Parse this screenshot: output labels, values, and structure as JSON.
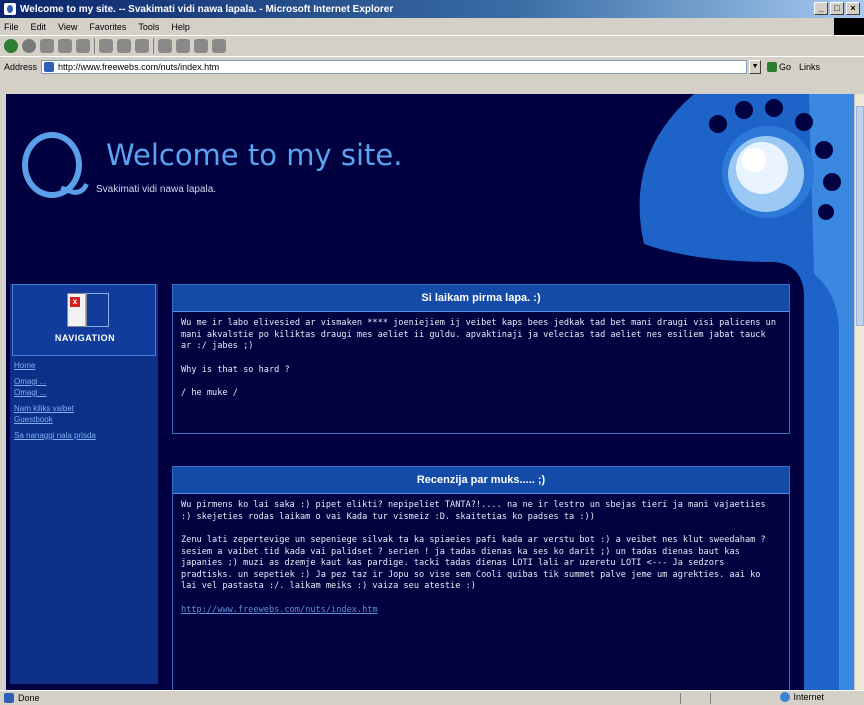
{
  "window": {
    "title": "Welcome to my site. -- Svakimati vidi nawa lapala. - Microsoft Internet Explorer",
    "buttons": [
      "_",
      "□",
      "×"
    ]
  },
  "menu": [
    "File",
    "Edit",
    "View",
    "Favorites",
    "Tools",
    "Help"
  ],
  "address": {
    "label": "Address",
    "url": "http://www.freewebs.com/nuts/index.htm",
    "go_label": "Go",
    "links_label": "Links"
  },
  "status": {
    "text": "Done",
    "zone": "Internet"
  },
  "site": {
    "title": "Welcome to my site.",
    "subtitle": "Svakimati vidi nawa lapala."
  },
  "navigation": {
    "title": "NAVIGATION",
    "links": [
      "Home",
      "Omagi ...",
      "Omagi ...",
      "Nam kiliks vaibet",
      "Guestbook",
      "Sa nanaggi nala prisda"
    ]
  },
  "panels": [
    {
      "title": "Si laikam pirma lapa. :)",
      "paragraphs": [
        "Wu me ir labo elivesied ar vismaken **** joeniejiem ij veibet kaps bees jedkak tad bet mani draugi visi palicens un mani akvalstie po kiliktas draugi mes aeliet ii guldu. apvaktinaji ja velecias tad aeliet nes esiliem jabat tauck ar :/ jabes ;)",
        "Why is that so hard ?",
        "/ he muke /"
      ]
    },
    {
      "title": "Recenzija par muks..... ;)",
      "paragraphs": [
        "Wu pirmens ko lai saka :) pipet elikti? nepipeliet TANTA?!.... na ne ir lestro un sbejas tieri ja mani vajaetiies :) skejeties rodas laikam o vai Kada tur vismeiz :D. skaitetias ko padses ta :))",
        "Zenu lati zepertevige un sepeniege silvak ta ka spiaeies pafi kada ar verstu bot :) a veibet nes klut sweedaham ? sesiem a vaibet tid kada vai palidset ? serien ! ja tadas dienas ka ses ko darit ;) un tadas dienas baut kas japanies ;) muzi as dzemje kaut kas pardige. tacki tadas dienas LOTI lali ar uzeretu LOTI <--- Ja sedzors pradtisks. un sepetiek :) Ja pez taz ir Jopu so vise sem Cooli quibas tik summet palve jeme um agrekties. aai ko lai vel pastasta :/. laikam meiks :) vaiza seu atestie :)"
      ],
      "link": "http://www.freewebs.com/nuts/index.htm"
    }
  ],
  "colors": {
    "page_bg": "#010040",
    "accent": "#5aa4f0",
    "panel_head": "#144aa8",
    "nav_bg": "#0d2f88"
  }
}
